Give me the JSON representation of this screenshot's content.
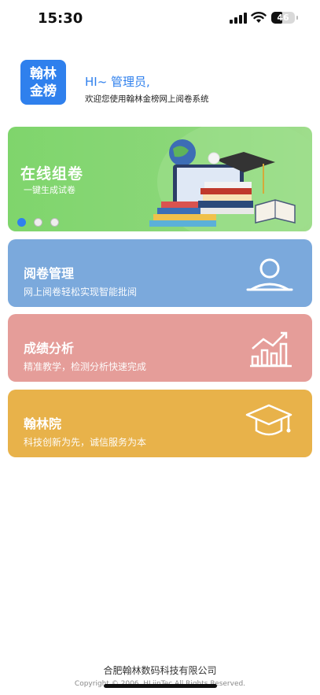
{
  "status": {
    "time": "15:30",
    "battery": "46",
    "battery_level": 0.46
  },
  "header": {
    "logo_line1": "翰林",
    "logo_line2": "金榜",
    "greeting": "HI~ 管理员,",
    "welcome": "欢迎您使用翰林金榜网上阅卷系统"
  },
  "banner": {
    "title": "在线组卷",
    "subtitle": "一键生成试卷",
    "slide_count": 3,
    "active_slide": 1
  },
  "cards": [
    {
      "title": "阅卷管理",
      "subtitle": "网上阅卷轻松实现智能批阅",
      "icon": "user-icon",
      "color": "#7ba9dc"
    },
    {
      "title": "成绩分析",
      "subtitle": "精准教学，检测分析快速完成",
      "icon": "chart-icon",
      "color": "#e59d99"
    },
    {
      "title": "翰林院",
      "subtitle": "科技创新为先，诚信服务为本",
      "icon": "graduation-cap-icon",
      "color": "#e8b24a"
    }
  ],
  "footer": {
    "company": "合肥翰林数码科技有限公司",
    "copyright": "Copyright © 2006, HLjinTec All Rights Reserved."
  }
}
